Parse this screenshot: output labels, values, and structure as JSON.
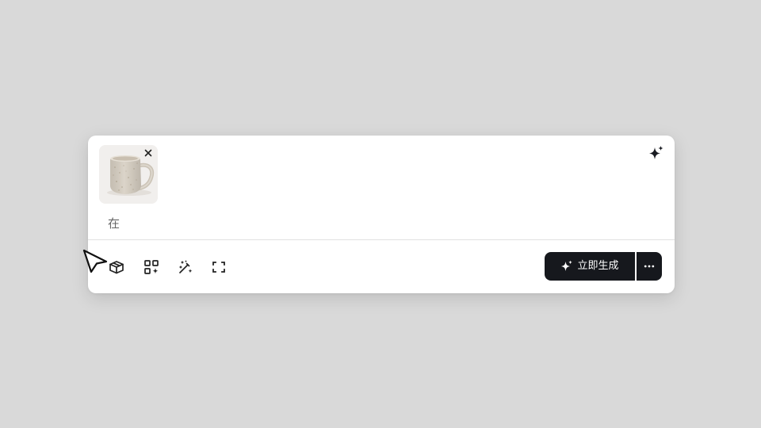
{
  "composer": {
    "attachment": {
      "name": "mug-image",
      "remove_icon": "close-icon"
    },
    "prompt_text": "在",
    "toolbar_icons": [
      "box-icon",
      "apps-add-icon",
      "magic-wand-icon",
      "expand-icon"
    ],
    "generate_label": "立即生成",
    "generate_icon": "sparkle-icon",
    "more_icon": "ellipsis-icon",
    "top_icon": "sparkle-icon"
  },
  "colors": {
    "background": "#d9d9d9",
    "card": "#ffffff",
    "button": "#16181d",
    "text_muted": "#666666"
  }
}
